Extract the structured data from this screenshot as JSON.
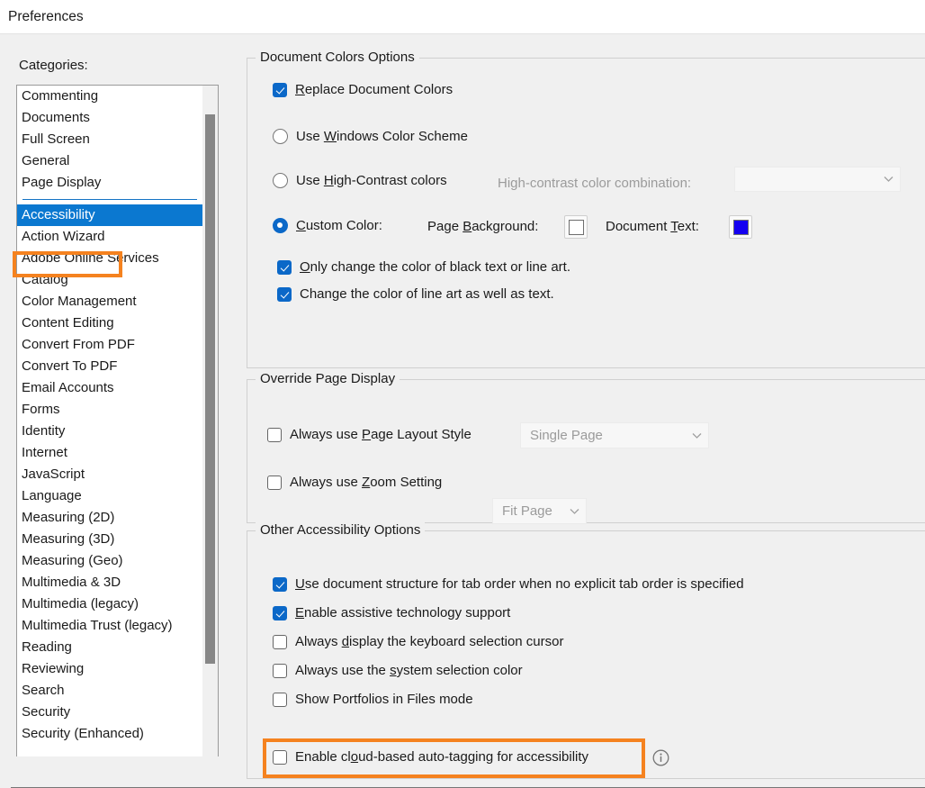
{
  "window": {
    "title": "Preferences"
  },
  "sidebar": {
    "label": "Categories:",
    "items_top": [
      {
        "label": "Commenting"
      },
      {
        "label": "Documents"
      },
      {
        "label": "Full Screen"
      },
      {
        "label": "General"
      },
      {
        "label": "Page Display"
      }
    ],
    "items_bottom": [
      {
        "label": "Accessibility",
        "selected": true
      },
      {
        "label": "Action Wizard"
      },
      {
        "label": "Adobe Online Services"
      },
      {
        "label": "Catalog"
      },
      {
        "label": "Color Management"
      },
      {
        "label": "Content Editing"
      },
      {
        "label": "Convert From PDF"
      },
      {
        "label": "Convert To PDF"
      },
      {
        "label": "Email Accounts"
      },
      {
        "label": "Forms"
      },
      {
        "label": "Identity"
      },
      {
        "label": "Internet"
      },
      {
        "label": "JavaScript"
      },
      {
        "label": "Language"
      },
      {
        "label": "Measuring (2D)"
      },
      {
        "label": "Measuring (3D)"
      },
      {
        "label": "Measuring (Geo)"
      },
      {
        "label": "Multimedia & 3D"
      },
      {
        "label": "Multimedia (legacy)"
      },
      {
        "label": "Multimedia Trust (legacy)"
      },
      {
        "label": "Reading"
      },
      {
        "label": "Reviewing"
      },
      {
        "label": "Search"
      },
      {
        "label": "Security"
      },
      {
        "label": "Security (Enhanced)"
      }
    ]
  },
  "document_colors": {
    "title": "Document Colors Options",
    "replace_document_colors": {
      "label_pre": "",
      "accel": "R",
      "label_post": "eplace Document Colors",
      "checked": true
    },
    "use_windows_color_scheme": {
      "label_pre": "Use ",
      "accel": "W",
      "label_post": "indows Color Scheme",
      "selected": false
    },
    "use_high_contrast": {
      "label_pre": "Use ",
      "accel": "H",
      "label_post": "igh-Contrast colors",
      "selected": false
    },
    "high_contrast_combo": {
      "label": "High-contrast color combination:",
      "value": "",
      "disabled": true
    },
    "custom_color": {
      "label_pre": "",
      "accel": "C",
      "label_post": "ustom Color:",
      "selected": true
    },
    "page_background": {
      "label_pre": "Page ",
      "accel": "B",
      "label_post": "ackground:",
      "color": "#ffffff"
    },
    "document_text": {
      "label_pre": "Document ",
      "accel": "T",
      "label_post": "ext:",
      "color": "#1400f0"
    },
    "only_change_black": {
      "label_pre": "",
      "accel": "O",
      "label_post": "nly change the color of black text or line art.",
      "checked": true
    },
    "change_line_art": {
      "label_pre": "Chan",
      "accel": "g",
      "label_post": "e the color of line art as well as text.",
      "checked": true
    }
  },
  "override_page_display": {
    "title": "Override Page Display",
    "page_layout": {
      "label_pre": "Always use ",
      "accel": "P",
      "label_post": "age Layout Style",
      "checked": false
    },
    "page_layout_combo": {
      "value": "Single Page",
      "disabled": true
    },
    "zoom_setting": {
      "label_pre": "Always use ",
      "accel": "Z",
      "label_post": "oom Setting",
      "checked": false
    },
    "zoom_combo": {
      "value": "Fit Page",
      "disabled": true
    }
  },
  "other_accessibility": {
    "title": "Other Accessibility Options",
    "tab_order": {
      "label_pre": "",
      "accel": "U",
      "label_post": "se document structure for tab order when no explicit tab order is specified",
      "checked": true
    },
    "assistive_tech": {
      "label_pre": "",
      "accel": "E",
      "label_post": "nable assistive technology support",
      "checked": true
    },
    "keyboard_cursor": {
      "label_pre": "Always ",
      "accel": "d",
      "label_post": "isplay the keyboard selection cursor",
      "checked": false
    },
    "system_selection_color": {
      "label_pre": "Always use the ",
      "accel": "s",
      "label_post": "ystem selection color",
      "checked": false
    },
    "show_portfolios": {
      "label_pre": "Show Portfolios in Files mode",
      "accel": "",
      "label_post": "",
      "checked": false
    },
    "cloud_auto_tagging": {
      "label_pre": "Enable cl",
      "accel": "o",
      "label_post": "ud-based auto-tagging for accessibility",
      "checked": false
    },
    "info_tooltip_name": "info-icon"
  },
  "colors": {
    "accent_blue": "#0b78d0",
    "annotation_orange": "#f5821f",
    "checkbox_blue": "#0b68c8"
  }
}
